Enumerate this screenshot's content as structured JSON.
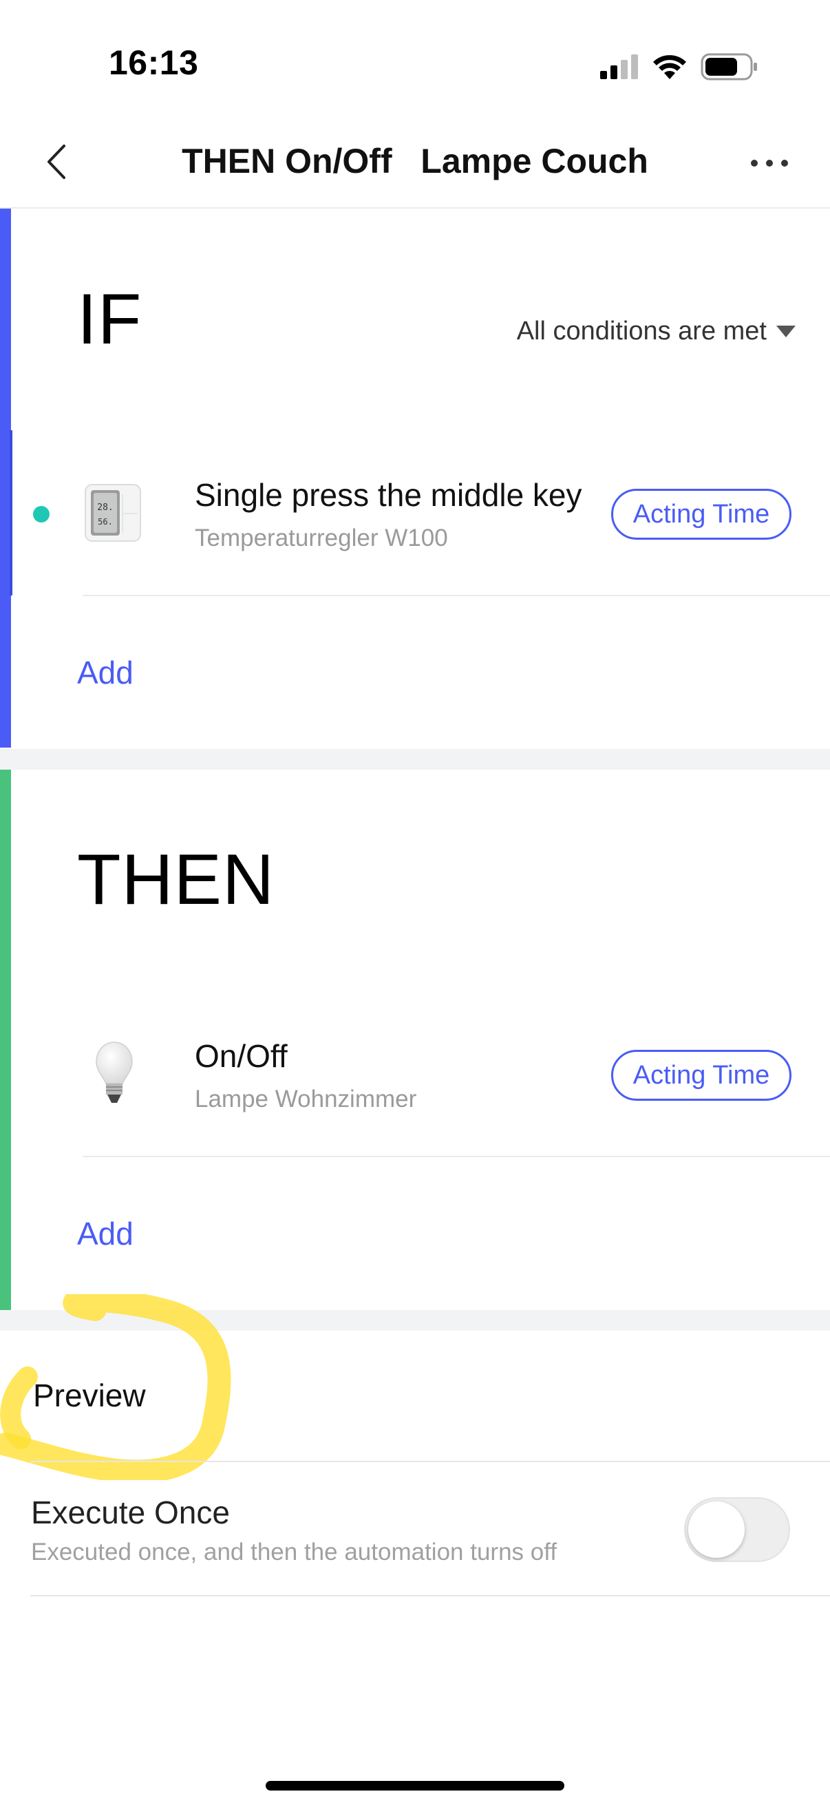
{
  "status_bar": {
    "time": "16:13",
    "icons": [
      "cellular-signal-icon",
      "wifi-icon",
      "battery-icon"
    ]
  },
  "nav": {
    "title": "THEN On/Off   Lampe Couch",
    "back_icon": "chevron-left-icon",
    "more_icon": "more-dots-icon"
  },
  "if_section": {
    "heading": "IF",
    "condition_mode": "All conditions are met",
    "conditions": [
      {
        "title": "Single press the middle key",
        "device": "Temperaturregler W100",
        "icon": "thermostat-device-icon",
        "action_label": "Acting Time"
      }
    ],
    "add_label": "Add"
  },
  "then_section": {
    "heading": "THEN",
    "actions": [
      {
        "title": "On/Off",
        "device": "Lampe Wohnzimmer",
        "icon": "light-bulb-icon",
        "action_label": "Acting Time"
      }
    ],
    "add_label": "Add"
  },
  "preview": {
    "label": "Preview"
  },
  "execute_once": {
    "title": "Execute Once",
    "description": "Executed once, and then the automation turns off",
    "enabled": false
  },
  "colors": {
    "accent": "#4a5cf5",
    "if_bar": "#4a5cf5",
    "then_bar": "#48c27c",
    "condition_dot": "#1ec8b5",
    "highlight": "#ffe033"
  }
}
